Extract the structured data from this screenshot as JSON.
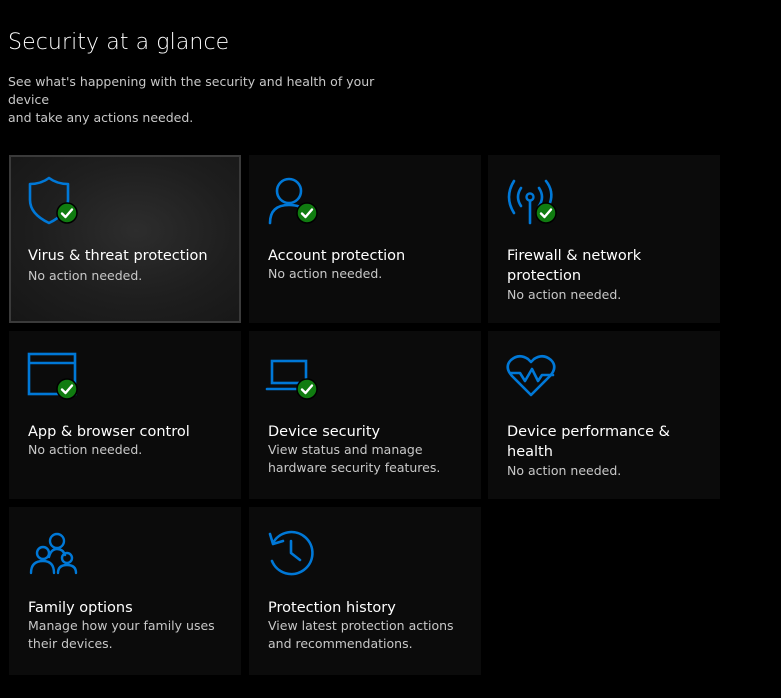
{
  "header": {
    "title": "Security at a glance",
    "subtitle_line1": "See what's happening with the security and health of your device",
    "subtitle_line2": "and take any actions needed."
  },
  "accent_color": "#0078d7",
  "ok_badge_color": "#107c10",
  "tiles": [
    {
      "label": "Virus & threat protection",
      "status": [
        "No action needed."
      ],
      "icon": "shield-icon",
      "ok": true
    },
    {
      "label": "Account protection",
      "status": [
        "No action needed."
      ],
      "icon": "person-icon",
      "ok": true
    },
    {
      "label_lines": [
        "Firewall & network",
        "protection"
      ],
      "status": [
        "No action needed."
      ],
      "icon": "wifi-antenna-icon",
      "ok": true
    },
    {
      "label": "App & browser control",
      "status": [
        "No action needed."
      ],
      "icon": "browser-window-icon",
      "ok": true
    },
    {
      "label": "Device security",
      "status": [
        "View status and manage",
        "hardware security features."
      ],
      "icon": "laptop-icon",
      "ok": true
    },
    {
      "label_lines": [
        "Device performance &",
        "health"
      ],
      "status": [
        "No action needed."
      ],
      "icon": "heart-pulse-icon",
      "ok": false
    },
    {
      "label": "Family options",
      "status": [
        "Manage how your family uses",
        "their devices."
      ],
      "icon": "family-icon",
      "ok": false
    },
    {
      "label": "Protection history",
      "status": [
        "View latest protection actions",
        "and recommendations."
      ],
      "icon": "history-clock-icon",
      "ok": false
    }
  ]
}
